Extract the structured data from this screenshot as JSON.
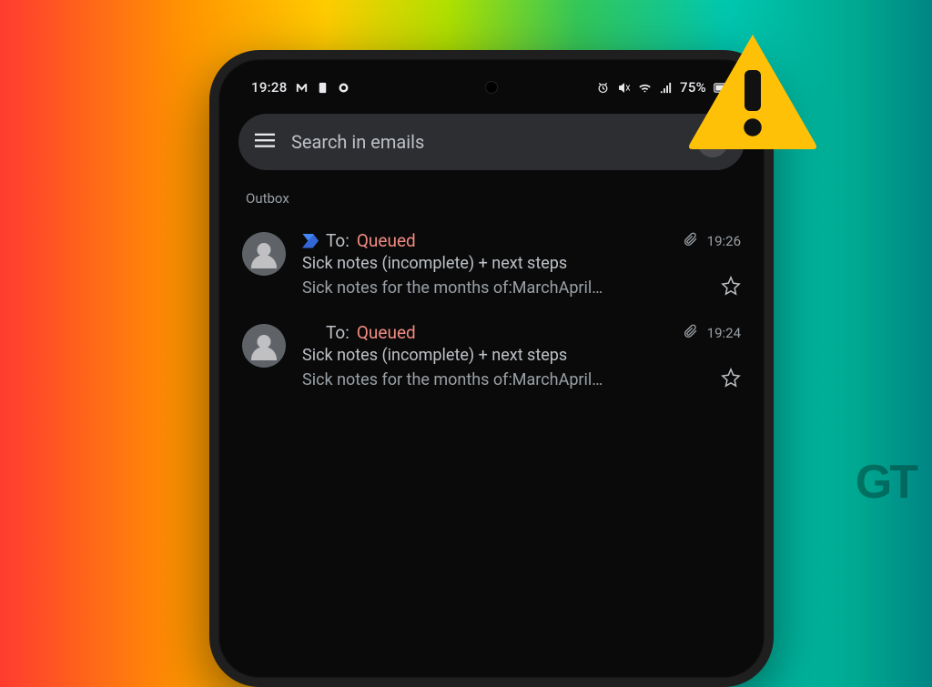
{
  "statusbar": {
    "time": "19:28",
    "battery": "75%"
  },
  "search": {
    "placeholder": "Search in emails"
  },
  "section": "Outbox",
  "emails": [
    {
      "to_label": "To:",
      "status": "Queued",
      "time": "19:26",
      "subject": "Sick notes (incomplete) + next steps",
      "preview": "Sick notes for the months of:MarchApril…",
      "has_chevron": true
    },
    {
      "to_label": "To:",
      "status": "Queued",
      "time": "19:24",
      "subject": "Sick notes (incomplete) + next steps",
      "preview": "Sick notes for the months of:MarchApril…",
      "has_chevron": false
    }
  ],
  "watermark": "GT"
}
